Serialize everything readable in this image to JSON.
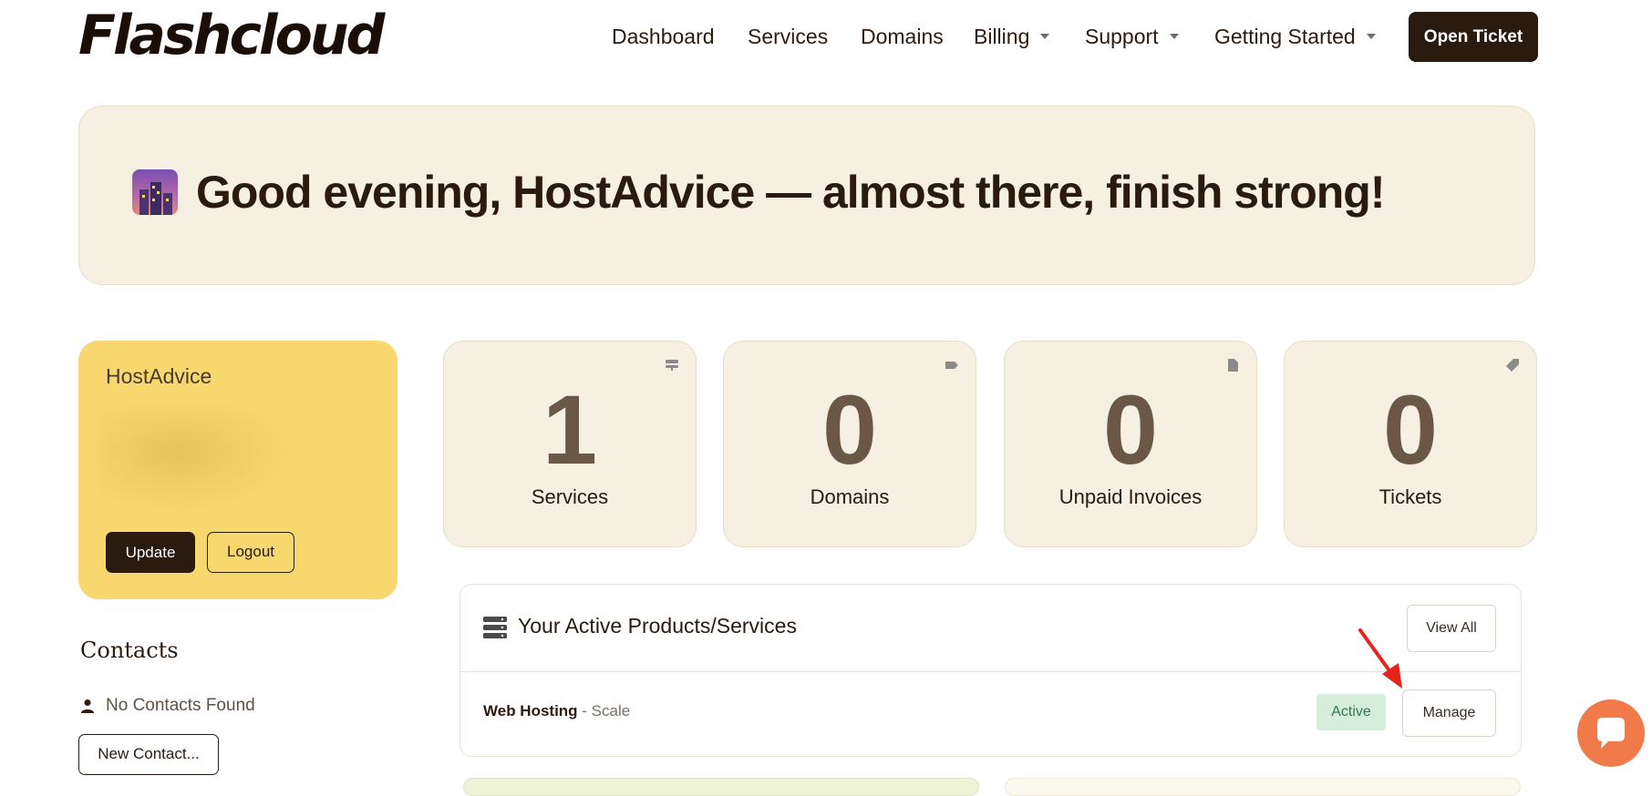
{
  "brand": {
    "logo_text": "Flashcloud"
  },
  "nav": {
    "items": [
      {
        "label": "Dashboard",
        "dropdown": false
      },
      {
        "label": "Services",
        "dropdown": false
      },
      {
        "label": "Domains",
        "dropdown": false
      },
      {
        "label": "Billing",
        "dropdown": true
      },
      {
        "label": "Support",
        "dropdown": true
      },
      {
        "label": "Getting Started",
        "dropdown": true
      }
    ],
    "cta_label": "Open Ticket"
  },
  "banner": {
    "emoji_icon": "night-city-icon",
    "greeting": "Good evening, HostAdvice — almost there, finish strong!"
  },
  "profile": {
    "name": "HostAdvice",
    "update_label": "Update",
    "logout_label": "Logout"
  },
  "contacts": {
    "title": "Contacts",
    "empty_text": "No Contacts Found",
    "new_label": "New Contact..."
  },
  "stats": [
    {
      "value": "1",
      "label": "Services",
      "icon": "server-icon"
    },
    {
      "value": "0",
      "label": "Domains",
      "icon": "tag-icon"
    },
    {
      "value": "0",
      "label": "Unpaid Invoices",
      "icon": "document-icon"
    },
    {
      "value": "0",
      "label": "Tickets",
      "icon": "ticket-icon"
    }
  ],
  "products": {
    "title": "Your Active Products/Services",
    "view_all_label": "View All",
    "items": [
      {
        "name": "Web Hosting",
        "plan": " - Scale",
        "status": "Active",
        "action_label": "Manage"
      }
    ]
  },
  "colors": {
    "brand_dark": "#2b1a0e",
    "banner_bg": "#f5f0e1",
    "profile_bg": "#f8d86e",
    "stat_number": "#6b5745",
    "active_badge_bg": "#d4eedb",
    "active_badge_text": "#2f7a45",
    "chat_bubble": "#f07a4a",
    "annotation_arrow": "#e8231c"
  }
}
